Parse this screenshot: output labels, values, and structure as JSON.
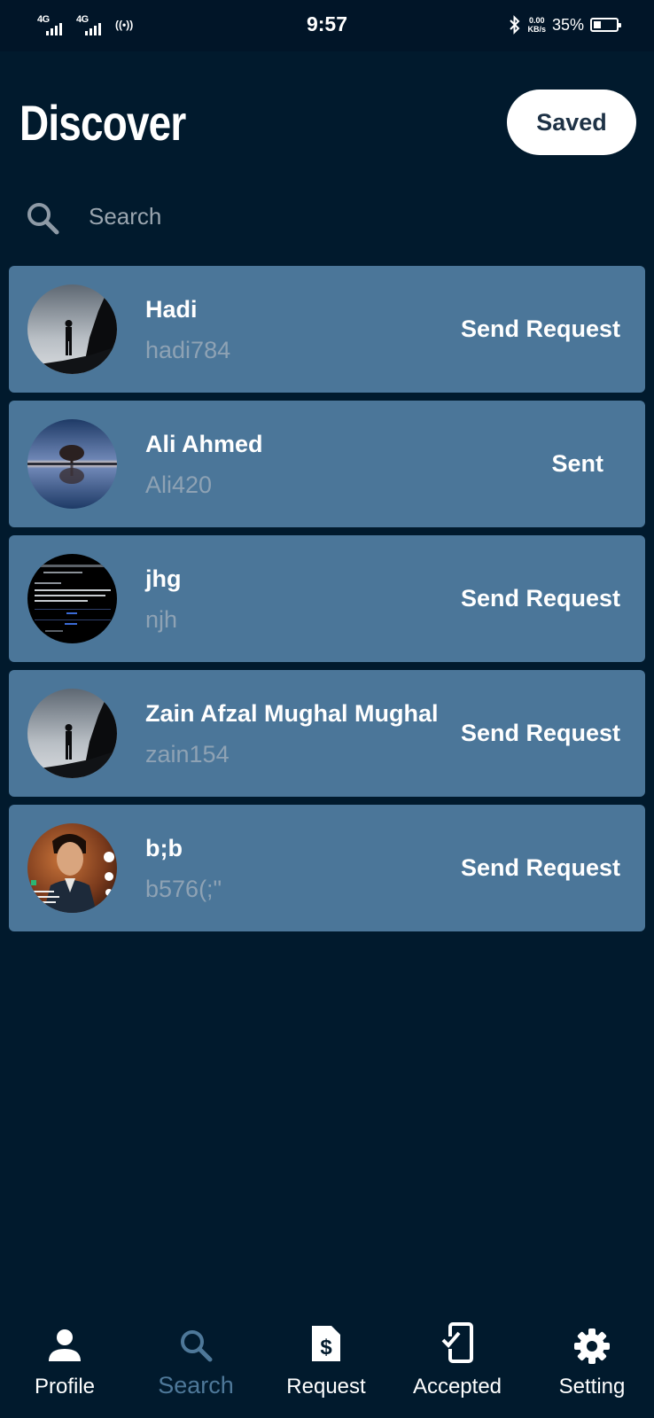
{
  "status_bar": {
    "sim1": "4G",
    "sim2": "4G",
    "wifi_calling": "((•))",
    "time": "9:57",
    "speed_value": "0.00",
    "speed_unit": "KB/s",
    "battery_percent": "35%",
    "battery_level": 0.35
  },
  "header": {
    "title": "Discover",
    "saved_label": "Saved"
  },
  "search": {
    "placeholder": "Search",
    "value": ""
  },
  "users": [
    {
      "name": "Hadi",
      "username": "hadi784",
      "action": "Send Request",
      "avatar": "silhouette-cliff"
    },
    {
      "name": "Ali Ahmed",
      "username": "Ali420",
      "action": "Sent",
      "avatar": "tree-reflection"
    },
    {
      "name": "jhg",
      "username": "njh",
      "action": "Send Request",
      "avatar": "screenshot"
    },
    {
      "name": "Zain Afzal Mughal Mughal",
      "username": "zain154",
      "action": "Send Request",
      "avatar": "silhouette-cliff"
    },
    {
      "name": "b;b",
      "username": "b576(;\"",
      "action": "Send Request",
      "avatar": "portrait"
    }
  ],
  "nav": {
    "items": [
      {
        "label": "Profile",
        "icon": "person-icon"
      },
      {
        "label": "Search",
        "icon": "search-icon"
      },
      {
        "label": "Request",
        "icon": "dollar-document-icon"
      },
      {
        "label": "Accepted",
        "icon": "phone-check-icon"
      },
      {
        "label": "Setting",
        "icon": "gear-icon"
      }
    ],
    "active": "Search"
  },
  "colors": {
    "background": "#011a2d",
    "card": "#4b7699",
    "active_nav": "#4e7899",
    "username_text": "#8ea2b4"
  }
}
